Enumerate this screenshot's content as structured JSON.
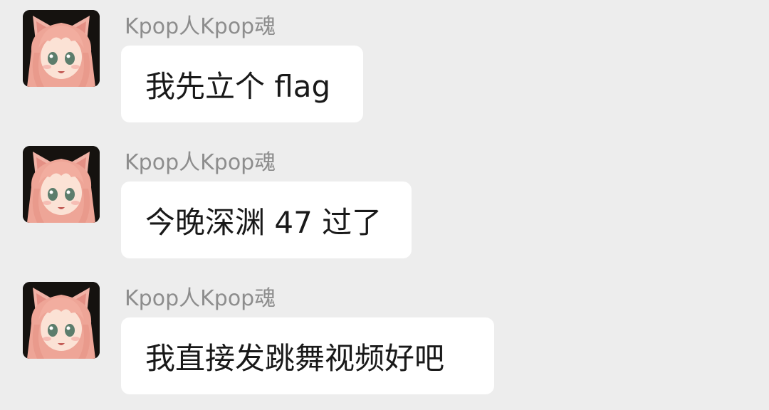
{
  "chat": {
    "messages": [
      {
        "sender": "Kpop人Kpop魂",
        "avatar_icon": "anime-girl-avatar",
        "text": "我先立个 flag"
      },
      {
        "sender": "Kpop人Kpop魂",
        "avatar_icon": "anime-girl-avatar",
        "text": "今晚深渊 47 过了"
      },
      {
        "sender": "Kpop人Kpop魂",
        "avatar_icon": "anime-girl-avatar",
        "text": "我直接发跳舞视频好吧"
      }
    ]
  },
  "colors": {
    "background": "#ededed",
    "bubble": "#ffffff",
    "sender_text": "#8d8d8d",
    "message_text": "#191919"
  }
}
